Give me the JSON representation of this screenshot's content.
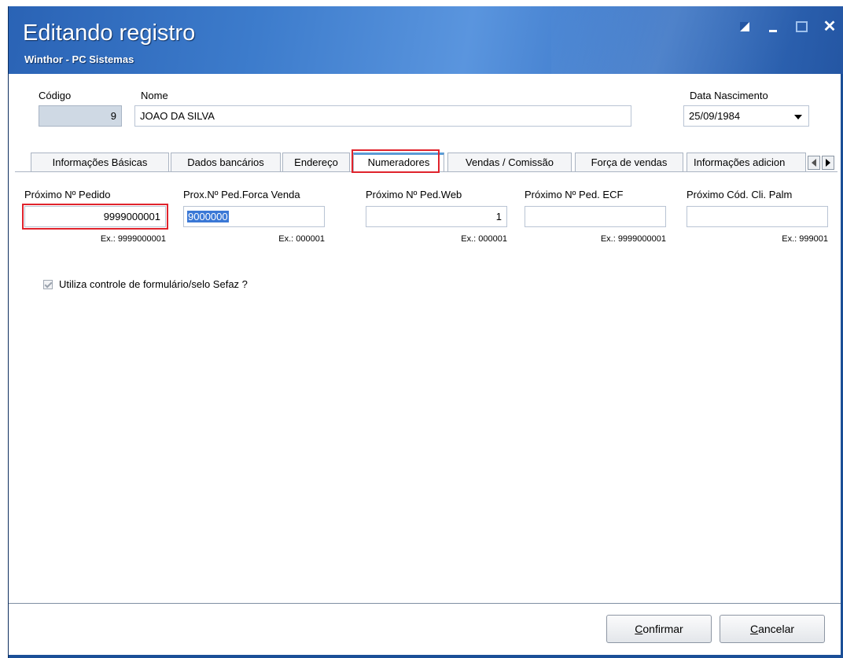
{
  "window": {
    "title": "Editando registro",
    "subtitle": "Winthor - PC Sistemas"
  },
  "header": {
    "codigo_label": "Código",
    "codigo_value": "9",
    "nome_label": "Nome",
    "nome_value": "JOAO DA SILVA",
    "nascimento_label": "Data Nascimento",
    "nascimento_value": "25/09/1984"
  },
  "tabs": [
    {
      "label": "Informações Básicas"
    },
    {
      "label": "Dados bancários"
    },
    {
      "label": "Endereço"
    },
    {
      "label": "Numeradores"
    },
    {
      "label": "Vendas  / Comissão"
    },
    {
      "label": "Força de vendas"
    },
    {
      "label": "Informações adicion"
    }
  ],
  "active_tab": "Numeradores",
  "numeradores": {
    "fields": [
      {
        "label": "Próximo Nº Pedido",
        "value": "9999000001",
        "example": "Ex.: 9999000001"
      },
      {
        "label": "Prox.Nº Ped.Forca Venda",
        "value": "9000000",
        "example": "Ex.: 000001"
      },
      {
        "label": "Próximo Nº Ped.Web",
        "value": "1",
        "example": "Ex.: 000001"
      },
      {
        "label": "Próximo Nº Ped. ECF",
        "value": "",
        "example": "Ex.: 9999000001"
      },
      {
        "label": "Próximo Cód. Cli. Palm",
        "value": "",
        "example": "Ex.: 999001"
      }
    ],
    "checkbox_label": "Utiliza controle de formulário/selo Sefaz ?",
    "checkbox_checked": true
  },
  "buttons": {
    "confirm_first": "C",
    "confirm_rest": "onfirmar",
    "cancel_first": "C",
    "cancel_rest": "ancelar"
  },
  "colors": {
    "titlebar": "#2a63b5",
    "highlight": "#e0232c",
    "selection": "#3a78d6"
  }
}
